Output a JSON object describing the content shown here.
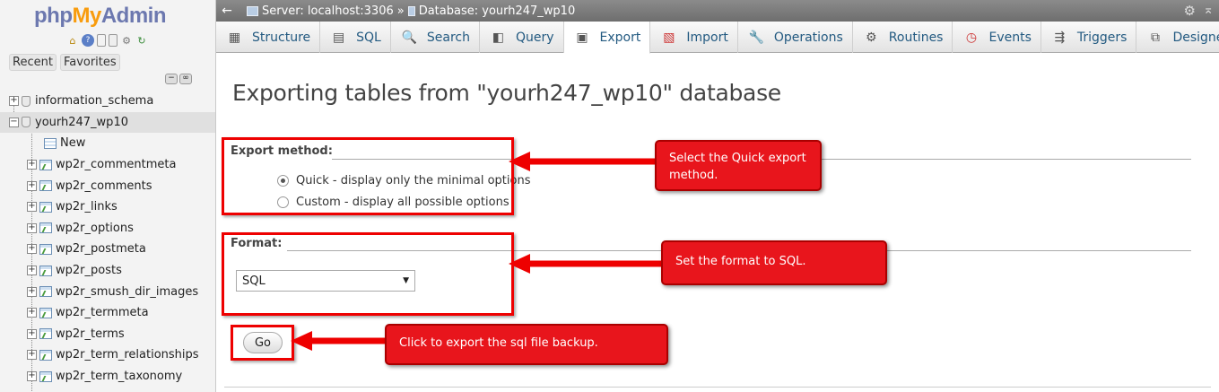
{
  "nav": {
    "logo": {
      "part1": "php",
      "part2": "MyAdmin"
    },
    "tabs": [
      "Recent",
      "Favorites"
    ],
    "icons": [
      "home-icon",
      "help-icon",
      "docs-icon",
      "settings-icon",
      "reload-icon"
    ],
    "tree": [
      {
        "label": "information_schema",
        "type": "db",
        "expander": "+"
      },
      {
        "label": "yourh247_wp10",
        "type": "db",
        "expander": "−",
        "selected": true
      },
      {
        "label": "New",
        "type": "new"
      },
      {
        "label": "wp2r_commentmeta",
        "type": "table",
        "expander": "+"
      },
      {
        "label": "wp2r_comments",
        "type": "table",
        "expander": "+"
      },
      {
        "label": "wp2r_links",
        "type": "table",
        "expander": "+"
      },
      {
        "label": "wp2r_options",
        "type": "table",
        "expander": "+"
      },
      {
        "label": "wp2r_postmeta",
        "type": "table",
        "expander": "+"
      },
      {
        "label": "wp2r_posts",
        "type": "table",
        "expander": "+"
      },
      {
        "label": "wp2r_smush_dir_images",
        "type": "table",
        "expander": "+"
      },
      {
        "label": "wp2r_termmeta",
        "type": "table",
        "expander": "+"
      },
      {
        "label": "wp2r_terms",
        "type": "table",
        "expander": "+"
      },
      {
        "label": "wp2r_term_relationships",
        "type": "table",
        "expander": "+"
      },
      {
        "label": "wp2r_term_taxonomy",
        "type": "table",
        "expander": "+"
      }
    ]
  },
  "topbar": {
    "back": "←",
    "server": "Server: localhost:3306",
    "separator": "»",
    "database": "Database: yourh247_wp10"
  },
  "tabs": [
    {
      "label": "Structure",
      "icon": "structure-icon",
      "glyph": "▦"
    },
    {
      "label": "SQL",
      "icon": "sql-icon",
      "glyph": "▤"
    },
    {
      "label": "Search",
      "icon": "search-icon",
      "glyph": "🔍"
    },
    {
      "label": "Query",
      "icon": "query-icon",
      "glyph": "◧"
    },
    {
      "label": "Export",
      "icon": "export-icon",
      "glyph": "▣",
      "active": true
    },
    {
      "label": "Import",
      "icon": "import-icon",
      "glyph": "▧"
    },
    {
      "label": "Operations",
      "icon": "wrench-icon",
      "glyph": "🔧"
    },
    {
      "label": "Routines",
      "icon": "routines-icon",
      "glyph": "⚙"
    },
    {
      "label": "Events",
      "icon": "clock-icon",
      "glyph": "◷"
    },
    {
      "label": "Triggers",
      "icon": "triggers-icon",
      "glyph": "⇶"
    },
    {
      "label": "Designer",
      "icon": "designer-icon",
      "glyph": "⧉"
    }
  ],
  "main": {
    "title": "Exporting tables from \"yourh247_wp10\" database",
    "export_method": {
      "legend": "Export method:",
      "options": [
        {
          "label": "Quick - display only the minimal options",
          "checked": true
        },
        {
          "label": "Custom - display all possible options",
          "checked": false
        }
      ]
    },
    "format": {
      "legend": "Format:",
      "selected": "SQL"
    },
    "go_label": "Go"
  },
  "annotations": {
    "color": "#e8151c",
    "method_note": "Select the Quick export method.",
    "format_note": "Set the format to SQL.",
    "go_note": "Click to export the sql file backup."
  }
}
